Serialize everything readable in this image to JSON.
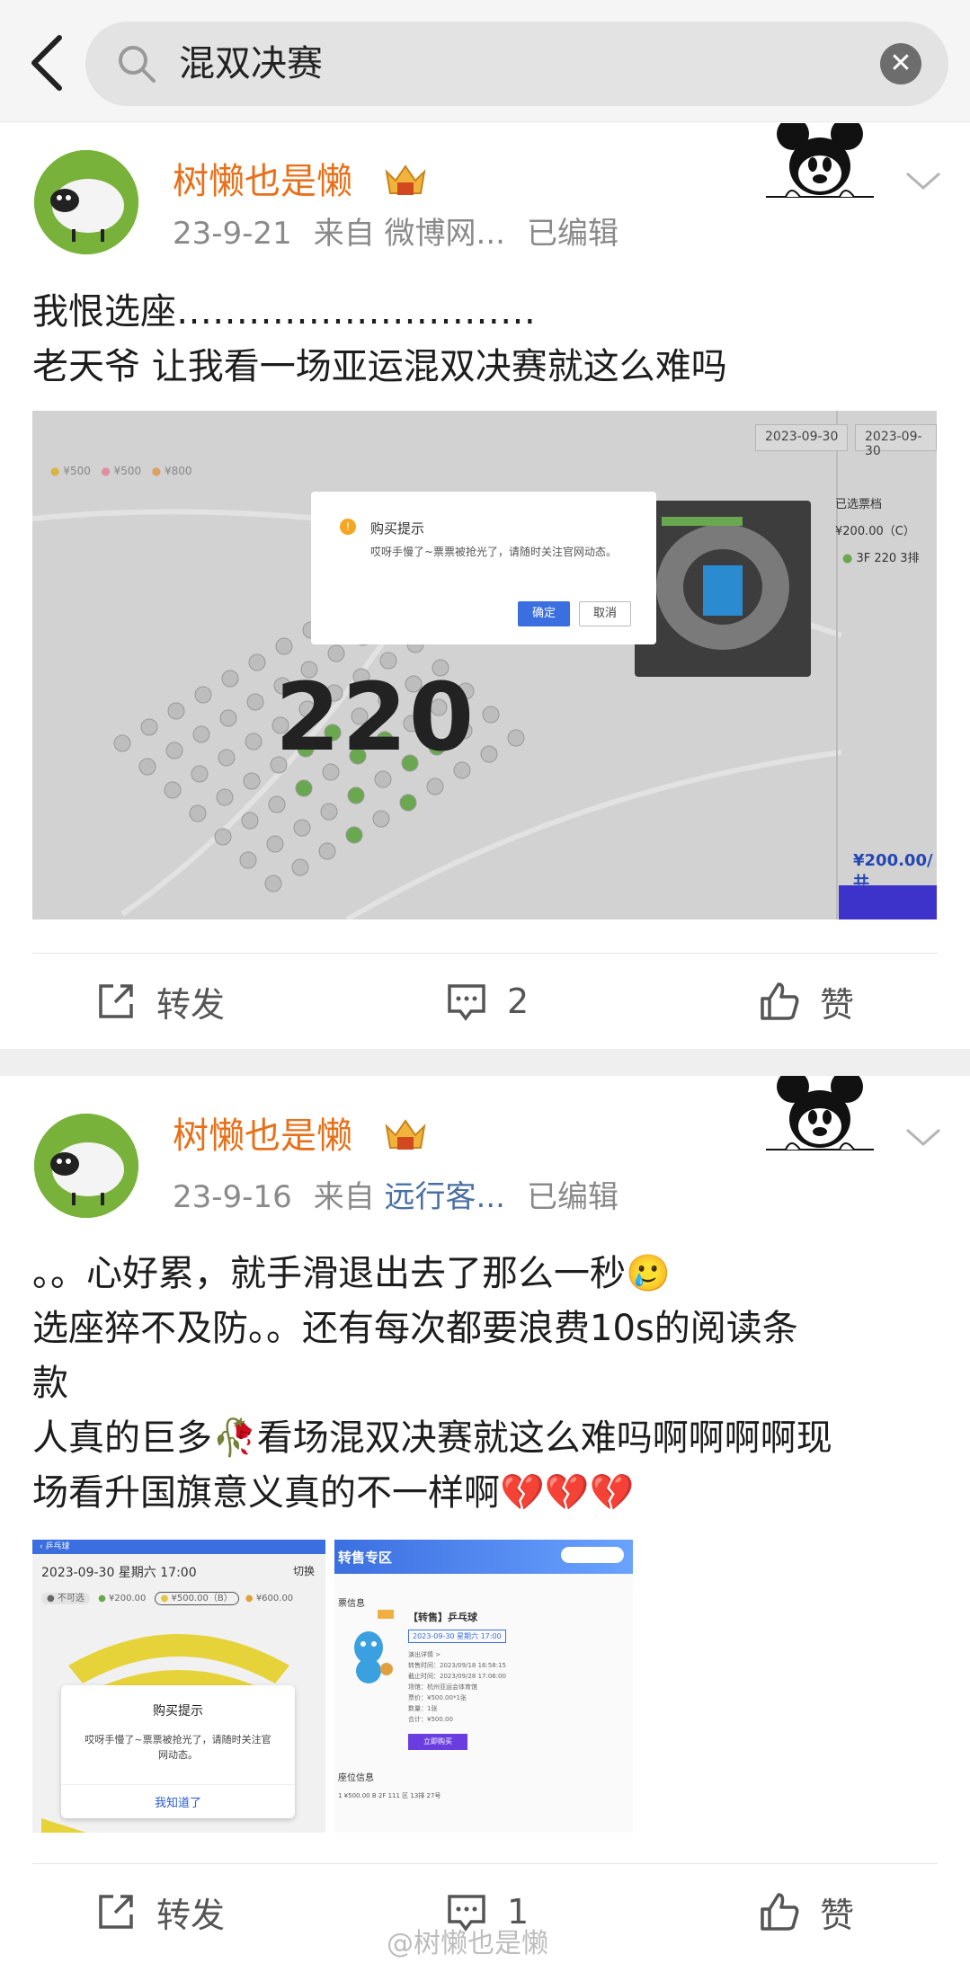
{
  "search": {
    "query": "混双决赛"
  },
  "posts": [
    {
      "username": "树懒也是懒",
      "date": "23-9-21",
      "source_prefix": "来自",
      "source": "微博网...",
      "edited": "已编辑",
      "text_lines": [
        "我恨选座…………………………",
        "老天爷 让我看一场亚运混双决赛就这么难吗"
      ],
      "screenshot": {
        "dates": [
          "2023-09-30",
          "2023-09-30"
        ],
        "legend": [
          "¥500",
          "¥500",
          "¥800"
        ],
        "dialog_title": "购买提示",
        "dialog_message": "哎呀手慢了~票票被抢光了，请随时关注官网动态。",
        "ok": "确定",
        "cancel": "取消",
        "section": "220",
        "panel_title": "已选票档",
        "panel_price": "¥200.00（C）",
        "panel_seat": "3F 220 3排",
        "total": "¥200.00/共"
      },
      "actions": {
        "repost": "转发",
        "comments": "2",
        "like": "赞"
      }
    },
    {
      "username": "树懒也是懒",
      "date": "23-9-16",
      "source_prefix": "来自",
      "source": "远行客...",
      "edited": "已编辑",
      "text_lines": [
        "。。心好累，就手滑退出去了那么一秒🥲",
        "选座猝不及防。。还有每次都要浪费10s的阅读条",
        "款",
        "人真的巨多🥀看场混双决赛就这么难吗啊啊啊啊现",
        "场看升国旗意义真的不一样啊💔💔💔"
      ],
      "screenshot_a": {
        "header": "乒乓球",
        "date_line": "2023-09-30 星期六 17:00",
        "switch": "切换",
        "legend": [
          "不可选",
          "¥200.00",
          "¥500.00（B）",
          "¥600.00"
        ],
        "dialog_title": "购买提示",
        "dialog_message": "哎呀手慢了~票票被抢光了，请随时关注官网动态。",
        "dialog_button": "我知道了"
      },
      "screenshot_b": {
        "banner": "转售专区",
        "section_label": "票信息",
        "item_title": "【转售】乒乓球",
        "item_date": "2023-09-30 星期六 17:00",
        "lines": [
          "演出详情 >",
          "转售时间：2023/09/18 16:58:15",
          "截止时间：2023/09/28 17:06:00",
          "场馆：杭州亚运会体育馆",
          "票价：¥500.00*1张",
          "数量：1张",
          "合计：¥500.00"
        ],
        "buy_button": "立即购买",
        "seat_section": "座位信息",
        "seat_row": "1   ¥500.00 B   2F 111 区 13排 27号"
      },
      "actions": {
        "repost": "转发",
        "comments": "1",
        "like": "赞"
      }
    }
  ],
  "watermark": "@树懒也是懒"
}
